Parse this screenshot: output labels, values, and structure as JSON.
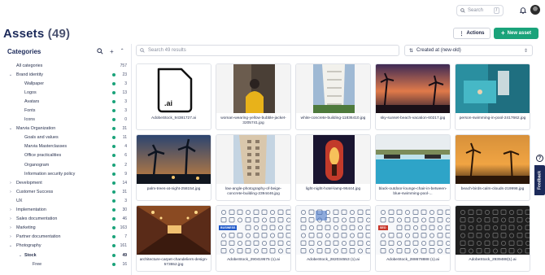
{
  "topbar": {
    "search_placeholder": "Search",
    "search_shortcut": "/"
  },
  "header": {
    "title": "Assets",
    "count": "(49)",
    "actions_label": "Actions",
    "new_asset_label": "New asset"
  },
  "sidebar": {
    "heading": "Categories",
    "items": [
      {
        "label": "All categories",
        "count": "757",
        "level": 0,
        "chevron": "",
        "dot": false,
        "bold": false
      },
      {
        "label": "Brand identity",
        "count": "23",
        "level": 0,
        "chevron": "v",
        "dot": true,
        "bold": false
      },
      {
        "label": "Wallpaper",
        "count": "3",
        "level": 1,
        "chevron": "",
        "dot": true,
        "bold": false
      },
      {
        "label": "Logos",
        "count": "13",
        "level": 1,
        "chevron": "",
        "dot": true,
        "bold": false
      },
      {
        "label": "Avatars",
        "count": "3",
        "level": 1,
        "chevron": "",
        "dot": true,
        "bold": false
      },
      {
        "label": "Fonts",
        "count": "3",
        "level": 1,
        "chevron": "",
        "dot": true,
        "bold": false
      },
      {
        "label": "Icons",
        "count": "0",
        "level": 1,
        "chevron": "",
        "dot": true,
        "bold": false
      },
      {
        "label": "Marvia Organization",
        "count": "31",
        "level": 0,
        "chevron": "v",
        "dot": true,
        "bold": false
      },
      {
        "label": "Goals and values",
        "count": "11",
        "level": 1,
        "chevron": "",
        "dot": true,
        "bold": false
      },
      {
        "label": "Marvia Masterclasses",
        "count": "4",
        "level": 1,
        "chevron": "",
        "dot": true,
        "bold": false
      },
      {
        "label": "Office practicalities",
        "count": "6",
        "level": 1,
        "chevron": "",
        "dot": true,
        "bold": false
      },
      {
        "label": "Organogram",
        "count": "2",
        "level": 1,
        "chevron": "",
        "dot": true,
        "bold": false
      },
      {
        "label": "Information security policy",
        "count": "9",
        "level": 1,
        "chevron": "",
        "dot": true,
        "bold": false
      },
      {
        "label": "Development",
        "count": "14",
        "level": 0,
        "chevron": ">",
        "dot": true,
        "bold": false
      },
      {
        "label": "Customer Success",
        "count": "31",
        "level": 0,
        "chevron": ">",
        "dot": true,
        "bold": false
      },
      {
        "label": "UX",
        "count": "3",
        "level": 0,
        "chevron": "",
        "dot": true,
        "bold": false
      },
      {
        "label": "Implementation",
        "count": "30",
        "level": 0,
        "chevron": ">",
        "dot": true,
        "bold": false
      },
      {
        "label": "Sales documentation",
        "count": "46",
        "level": 0,
        "chevron": ">",
        "dot": true,
        "bold": false
      },
      {
        "label": "Marketing",
        "count": "163",
        "level": 0,
        "chevron": ">",
        "dot": true,
        "bold": false
      },
      {
        "label": "Partner documentation",
        "count": "7",
        "level": 0,
        "chevron": ">",
        "dot": true,
        "bold": false
      },
      {
        "label": "Photography",
        "count": "161",
        "level": 0,
        "chevron": "v",
        "dot": true,
        "bold": false
      },
      {
        "label": "Stock",
        "count": "49",
        "level": 1,
        "chevron": "v",
        "dot": true,
        "bold": true
      },
      {
        "label": "Free",
        "count": "16",
        "level": 2,
        "chevron": "",
        "dot": true,
        "bold": false
      }
    ]
  },
  "main": {
    "search_placeholder": "Search 49 results",
    "sort_label": "Created at (new-old)",
    "assets": [
      {
        "name": "AdobeStock_94381727.ai",
        "thumb": "ai-file"
      },
      {
        "name": "woman-wearing-yellow-bubble-jacket-3205741.jpg",
        "thumb": "yellow-jacket"
      },
      {
        "name": "white-concrete-building-11836410.jpg",
        "thumb": "white-building"
      },
      {
        "name": "sky-sunset-beach-vacation-60217.jpg",
        "thumb": "sunset-beach"
      },
      {
        "name": "person-swimming-in-pool-2417662.jpg",
        "thumb": "swimming-pool"
      },
      {
        "name": "palm-trees-at-night-258154.jpg",
        "thumb": "palm-night"
      },
      {
        "name": "low-angle-photography-of-beige-concrete-building-2394446.jpg",
        "thumb": "beige-building"
      },
      {
        "name": "light-night-hotel-lamp-96444.jpg",
        "thumb": "hotel-lamp"
      },
      {
        "name": "black-outdoor-lounge-chair-in-between-blue-swimming-pool-...",
        "thumb": "lounge-pool"
      },
      {
        "name": "beach-birds-calm-clouds-219998.jpg",
        "thumb": "beach-birds"
      },
      {
        "name": "architecture-carpet-chandeliers-design-573552.jpg",
        "thumb": "hallway"
      },
      {
        "name": "AdobeStock_290419575 (1).ai",
        "thumb": "icons-business",
        "tag": "BUSINESS"
      },
      {
        "name": "AdobeStock_282034553 (1).ai",
        "thumb": "icons-grid"
      },
      {
        "name": "AdobeStock_288678888 (1).ai",
        "thumb": "icons-seo",
        "tag": "SEO"
      },
      {
        "name": "AdobeStock_2939488(1).ai",
        "thumb": "icons-dark"
      }
    ]
  },
  "widgets": {
    "help": "?",
    "feedback": "Feedback"
  },
  "colors": {
    "accent": "#1aa37a",
    "title": "#1c2a5a"
  }
}
